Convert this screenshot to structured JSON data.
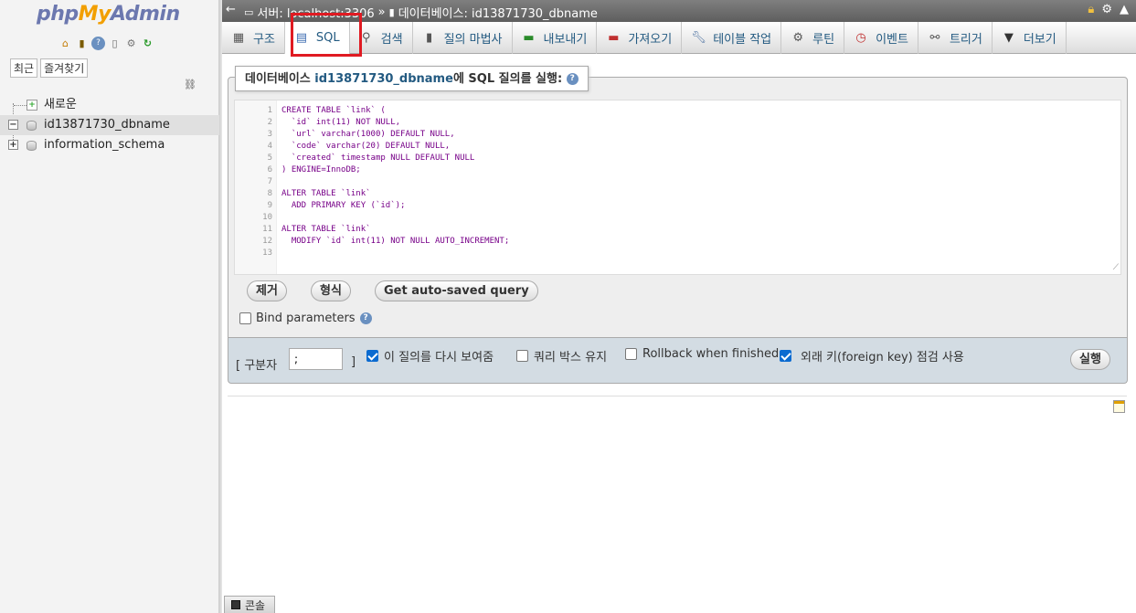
{
  "sidebar": {
    "logo": {
      "php": "php",
      "my": "My",
      "admin": "Admin"
    },
    "tabs": {
      "recent": "최근",
      "favorites": "즐겨찾기"
    },
    "tree": [
      {
        "label": "새로운",
        "kind": "new"
      },
      {
        "label": "id13871730_dbname",
        "kind": "db",
        "selected": true,
        "expander": "−"
      },
      {
        "label": "information_schema",
        "kind": "db",
        "selected": false,
        "expander": "+"
      }
    ]
  },
  "topbar": {
    "server": "서버: localhost:3306",
    "separator": "»",
    "database": "데이터베이스: id13871730_dbname"
  },
  "tabs": [
    {
      "label": "구조",
      "icon": "structure-icon"
    },
    {
      "label": "SQL",
      "icon": "sql-icon",
      "active": true
    },
    {
      "label": "검색",
      "icon": "search-icon"
    },
    {
      "label": "질의 마법사",
      "icon": "query-icon"
    },
    {
      "label": "내보내기",
      "icon": "export-icon"
    },
    {
      "label": "가져오기",
      "icon": "import-icon"
    },
    {
      "label": "테이블 작업",
      "icon": "wrench-icon"
    },
    {
      "label": "루틴",
      "icon": "routines-icon"
    },
    {
      "label": "이벤트",
      "icon": "events-icon"
    },
    {
      "label": "트리거",
      "icon": "triggers-icon"
    },
    {
      "label": "더보기",
      "icon": "chevron-down-icon"
    }
  ],
  "sql_panel": {
    "legend_prefix": "데이터베이스 ",
    "legend_db": "id13871730_dbname",
    "legend_suffix": "에 SQL 질의를 실행:",
    "code_lines": [
      "CREATE TABLE `link` (",
      "  `id` int(11) NOT NULL,",
      "  `url` varchar(1000) DEFAULT NULL,",
      "  `code` varchar(20) DEFAULT NULL,",
      "  `created` timestamp NULL DEFAULT NULL",
      ") ENGINE=InnoDB;",
      "",
      "ALTER TABLE `link`",
      "  ADD PRIMARY KEY (`id`);",
      "",
      "ALTER TABLE `link`",
      "  MODIFY `id` int(11) NOT NULL AUTO_INCREMENT;",
      ""
    ],
    "line_numbers": [
      "1",
      "2",
      "3",
      "4",
      "5",
      "6",
      "7",
      "8",
      "9",
      "10",
      "11",
      "12",
      "13"
    ],
    "buttons": {
      "clear": "제거",
      "format": "형식",
      "autosaved": "Get auto-saved query"
    },
    "bind_parameters": "Bind parameters"
  },
  "options": {
    "delimiter_label": "[ 구분자",
    "delimiter_value": ";",
    "delimiter_close": "]",
    "show_query_again": "이 질의를 다시 보여줌",
    "retain_query_box": "쿼리 박스 유지",
    "rollback": "Rollback when finished",
    "foreign_key_check": "외래 키(foreign key) 점검 사용",
    "go_button": "실행"
  },
  "console": {
    "label": "콘솔"
  }
}
